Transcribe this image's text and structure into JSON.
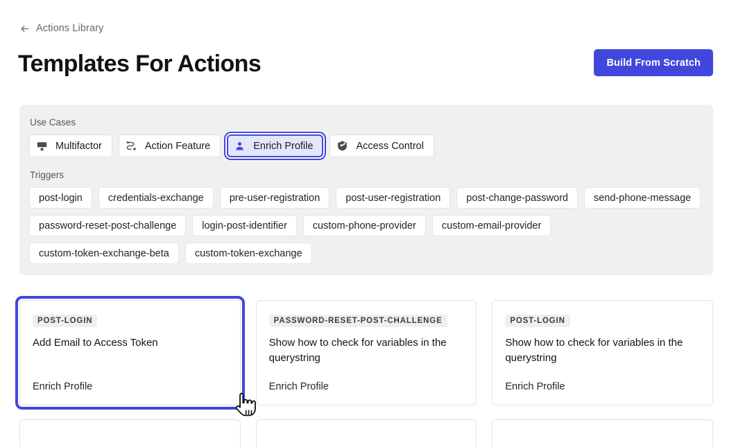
{
  "breadcrumb": {
    "icon": "arrow-left-icon",
    "label": "Actions Library"
  },
  "header": {
    "title": "Templates For Actions",
    "primary_button": "Build From Scratch"
  },
  "colors": {
    "accent": "#4147dd",
    "panel_bg": "#f0f0f0",
    "selected_chip_bg": "#e5e6fb",
    "card_border": "#e3e3e5",
    "tag_bg": "#efeff0"
  },
  "filters": {
    "use_cases_label": "Use Cases",
    "use_cases": [
      {
        "label": "Multifactor",
        "icon": "keypad-icon",
        "selected": false
      },
      {
        "label": "Action Feature",
        "icon": "flow-icon",
        "selected": false
      },
      {
        "label": "Enrich Profile",
        "icon": "person-icon",
        "selected": true
      },
      {
        "label": "Access Control",
        "icon": "shield-key-icon",
        "selected": false
      }
    ],
    "triggers_label": "Triggers",
    "triggers": [
      "post-login",
      "credentials-exchange",
      "pre-user-registration",
      "post-user-registration",
      "post-change-password",
      "send-phone-message",
      "password-reset-post-challenge",
      "login-post-identifier",
      "custom-phone-provider",
      "custom-email-provider",
      "custom-token-exchange-beta",
      "custom-token-exchange"
    ]
  },
  "templates": [
    {
      "tag": "POST-LOGIN",
      "title": "Add Email to Access Token",
      "use_case": "Enrich Profile",
      "focused": true
    },
    {
      "tag": "PASSWORD-RESET-POST-CHALLENGE",
      "title": "Show how to check for variables in the querystring",
      "use_case": "Enrich Profile",
      "focused": false
    },
    {
      "tag": "POST-LOGIN",
      "title": "Show how to check for variables in the querystring",
      "use_case": "Enrich Profile",
      "focused": false
    }
  ],
  "cursor": {
    "icon": "pointing-hand-cursor"
  }
}
